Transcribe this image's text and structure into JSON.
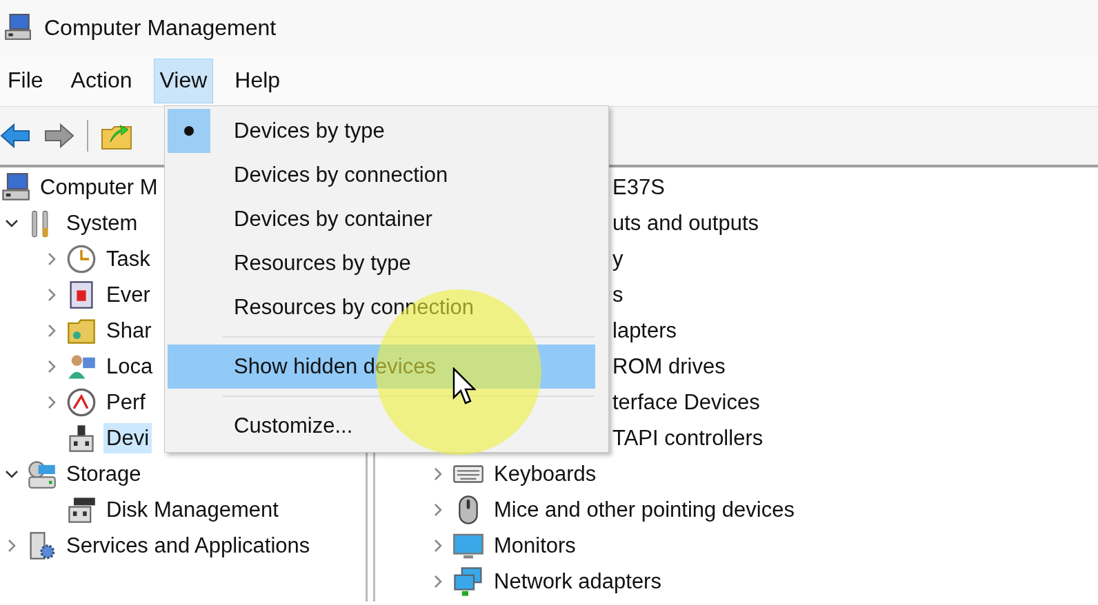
{
  "window": {
    "title": "Computer Management"
  },
  "menu_bar": [
    {
      "label": "File",
      "selected": false
    },
    {
      "label": "Action",
      "selected": false
    },
    {
      "label": "View",
      "selected": true
    },
    {
      "label": "Help",
      "selected": false
    }
  ],
  "left_tree": [
    {
      "label": "Computer M",
      "children": [
        {
          "label": "System",
          "expanded": true,
          "selected": false,
          "children": [
            {
              "label": "Task",
              "expanded": false,
              "selected": false
            },
            {
              "label": "Ever",
              "expanded": false,
              "selected": false
            },
            {
              "label": "Shar",
              "expanded": false,
              "selected": false
            },
            {
              "label": "Loca",
              "expanded": false,
              "selected": false
            },
            {
              "label": "Perf",
              "expanded": false,
              "selected": false
            },
            {
              "label": "Devi",
              "selected": true
            }
          ]
        },
        {
          "label": "Storage",
          "expanded": true,
          "selected": false,
          "children": [
            {
              "label": "Disk Management",
              "selected": false
            }
          ]
        },
        {
          "label": "Services and Applications",
          "expanded": false,
          "selected": false
        }
      ]
    }
  ],
  "right_tree": {
    "root": "E37S",
    "children": [
      {
        "kind": "clipped",
        "label": "uts and outputs"
      },
      {
        "kind": "clipped",
        "label": "y"
      },
      {
        "kind": "clipped",
        "label": "s"
      },
      {
        "kind": "clipped",
        "label": "lapters"
      },
      {
        "kind": "clipped",
        "label": "ROM drives"
      },
      {
        "kind": "clipped",
        "label": "terface Devices"
      },
      {
        "kind": "clipped",
        "label": "TAPI controllers"
      },
      {
        "kind": "full",
        "label": "Keyboards",
        "expanded": false
      },
      {
        "kind": "full",
        "label": "Mice and other pointing devices",
        "expanded": false
      },
      {
        "kind": "full",
        "label": "Monitors",
        "expanded": false
      },
      {
        "kind": "full",
        "label": "Network adapters",
        "expanded": false
      }
    ]
  },
  "view_menu": [
    {
      "kind": "item",
      "label": "Devices by type",
      "checked": true,
      "highlighted": false
    },
    {
      "kind": "item",
      "label": "Devices by connection",
      "checked": false,
      "highlighted": false
    },
    {
      "kind": "item",
      "label": "Devices by container",
      "checked": false,
      "highlighted": false
    },
    {
      "kind": "item",
      "label": "Resources by type",
      "checked": false,
      "highlighted": false
    },
    {
      "kind": "item",
      "label": "Resources by connection",
      "checked": false,
      "highlighted": false
    },
    {
      "kind": "separator"
    },
    {
      "kind": "item",
      "label": "Show hidden devices",
      "checked": false,
      "highlighted": true
    },
    {
      "kind": "separator"
    },
    {
      "kind": "item",
      "label": "Customize...",
      "checked": false,
      "highlighted": false
    }
  ]
}
